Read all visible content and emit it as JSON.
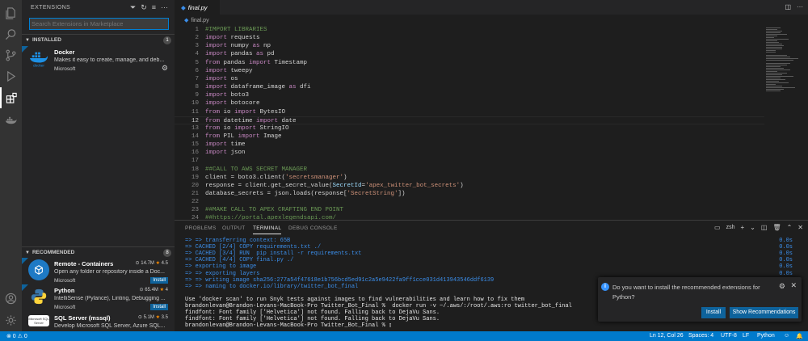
{
  "activity": {
    "icons": [
      "explorer-icon",
      "search-icon",
      "source-control-icon",
      "run-debug-icon",
      "extensions-icon",
      "docker-icon"
    ],
    "bottom": [
      "accounts-icon",
      "manage-icon"
    ]
  },
  "sidebar": {
    "title": "EXTENSIONS",
    "search_placeholder": "Search Extensions in Marketplace",
    "installed_label": "INSTALLED",
    "installed_count": "1",
    "installed": [
      {
        "name": "Docker",
        "desc": "Makes it easy to create, manage, and deb...",
        "publisher": "Microsoft",
        "logo_text": "docker",
        "color": "#1d91e6"
      }
    ],
    "recommended_label": "RECOMMENDED",
    "recommended_count": "8",
    "recommended": [
      {
        "name": "Remote - Containers",
        "downloads": "14.7M",
        "rating": "4.5",
        "desc": "Open any folder or repository inside a Doc...",
        "publisher": "Microsoft",
        "install": "Install",
        "color": "#1e7ac5"
      },
      {
        "name": "Python",
        "downloads": "65.4M",
        "rating": "4",
        "desc": "IntelliSense (Pylance), Linting, Debugging ...",
        "publisher": "Microsoft",
        "install": "Install",
        "color": "#3a6e9e"
      },
      {
        "name": "SQL Server (mssql)",
        "downloads": "5.1M",
        "rating": "3.5",
        "desc": "Develop Microsoft SQL Server, Azure SQL...",
        "publisher": "",
        "install": "",
        "color": "#ffffff",
        "logo_text": "Microsoft SQL Server"
      }
    ]
  },
  "editor": {
    "tab": "final.py",
    "breadcrumb": "final.py",
    "current_line": 12,
    "lines": [
      [
        [
          "c",
          "#IMPORT LIBRARIES"
        ]
      ],
      [
        [
          "k",
          "import"
        ],
        [
          "t",
          " requests"
        ]
      ],
      [
        [
          "k",
          "import"
        ],
        [
          "t",
          " numpy "
        ],
        [
          "k",
          "as"
        ],
        [
          "t",
          " np"
        ]
      ],
      [
        [
          "k",
          "import"
        ],
        [
          "t",
          " pandas "
        ],
        [
          "k",
          "as"
        ],
        [
          "t",
          " pd"
        ]
      ],
      [
        [
          "k",
          "from"
        ],
        [
          "t",
          " pandas "
        ],
        [
          "k",
          "import"
        ],
        [
          "t",
          " Timestamp"
        ]
      ],
      [
        [
          "k",
          "import"
        ],
        [
          "t",
          " tweepy"
        ]
      ],
      [
        [
          "k",
          "import"
        ],
        [
          "t",
          " os"
        ]
      ],
      [
        [
          "k",
          "import"
        ],
        [
          "t",
          " dataframe_image "
        ],
        [
          "k",
          "as"
        ],
        [
          "t",
          " dfi"
        ]
      ],
      [
        [
          "k",
          "import"
        ],
        [
          "t",
          " boto3"
        ]
      ],
      [
        [
          "k",
          "import"
        ],
        [
          "t",
          " botocore"
        ]
      ],
      [
        [
          "k",
          "from"
        ],
        [
          "t",
          " io "
        ],
        [
          "k",
          "import"
        ],
        [
          "t",
          " BytesIO"
        ]
      ],
      [
        [
          "k",
          "from"
        ],
        [
          "t",
          " datetime "
        ],
        [
          "k",
          "import"
        ],
        [
          "t",
          " date"
        ]
      ],
      [
        [
          "k",
          "from"
        ],
        [
          "t",
          " io "
        ],
        [
          "k",
          "import"
        ],
        [
          "t",
          " StringIO"
        ]
      ],
      [
        [
          "k",
          "from"
        ],
        [
          "t",
          " PIL "
        ],
        [
          "k",
          "import"
        ],
        [
          "t",
          " Image"
        ]
      ],
      [
        [
          "k",
          "import"
        ],
        [
          "t",
          " time"
        ]
      ],
      [
        [
          "k",
          "import"
        ],
        [
          "t",
          " json"
        ]
      ],
      [],
      [
        [
          "c",
          "##CALL TO AWS SECRET MANAGER"
        ]
      ],
      [
        [
          "t",
          "client = boto3.client("
        ],
        [
          "s",
          "'secretsmanager'"
        ],
        [
          "t",
          ")"
        ]
      ],
      [
        [
          "t",
          "response = client.get_secret_value("
        ],
        [
          "p",
          "SecretId"
        ],
        [
          "t",
          "="
        ],
        [
          "s",
          "'apex_twitter_bot_secrets'"
        ],
        [
          "t",
          ")"
        ]
      ],
      [
        [
          "t",
          "database_secrets = json.loads(response["
        ],
        [
          "s",
          "'SecretString'"
        ],
        [
          "t",
          "])"
        ]
      ],
      [],
      [
        [
          "c",
          "##MAKE CALL TO APEX CRAFTING END POINT"
        ]
      ],
      [
        [
          "c",
          "##https://portal.apexlegendsapi.com/"
        ]
      ]
    ]
  },
  "panel": {
    "tabs": [
      "PROBLEMS",
      "OUTPUT",
      "TERMINAL",
      "DEBUG CONSOLE"
    ],
    "active_tab": "TERMINAL",
    "shell": "zsh",
    "terminal": [
      {
        "text": "=> => transferring context: 65B",
        "right": "0.0s",
        "cls": "blue"
      },
      {
        "text": "=> CACHED [2/4] COPY requirements.txt ./",
        "right": "0.0s",
        "cls": "blue"
      },
      {
        "text": "=> CACHED [3/4] RUN  pip install -r requirements.txt",
        "right": "0.0s",
        "cls": "blue"
      },
      {
        "text": "=> CACHED [4/4] COPY final.py ./",
        "right": "0.0s",
        "cls": "blue"
      },
      {
        "text": "=> exporting to image",
        "right": "0.0s",
        "cls": "blue"
      },
      {
        "text": "=> => exporting layers",
        "right": "0.0s",
        "cls": "blue"
      },
      {
        "text": "=> => writing image sha256:277a54f47618e1b756bcd5ed91c2a5e9422fa9ff1cce031d413943546ddf6139",
        "right": "",
        "cls": "blue"
      },
      {
        "text": "=> => naming to docker.io/library/twitter_bot_final",
        "right": "",
        "cls": "blue"
      },
      {
        "text": "",
        "right": "",
        "cls": "w"
      },
      {
        "text": "Use 'docker scan' to run Snyk tests against images to find vulnerabilities and learn how to fix them",
        "right": "",
        "cls": "w"
      },
      {
        "text": "brandonlevan@Brandon-Levans-MacBook-Pro Twitter_Bot_Final %  docker run -v ~/.aws/:/root/.aws:ro twitter_bot_final",
        "right": "",
        "cls": "w"
      },
      {
        "text": "findfont: Font family ['Helvetica'] not found. Falling back to DejaVu Sans.",
        "right": "",
        "cls": "w"
      },
      {
        "text": "findfont: Font family ['Helvetica'] not found. Falling back to DejaVu Sans.",
        "right": "",
        "cls": "w"
      },
      {
        "text": "brandonlevan@Brandon-Levans-MacBook-Pro Twitter_Bot_Final % ▯",
        "right": "",
        "cls": "w"
      }
    ]
  },
  "notification": {
    "text": "Do you want to install the recommended extensions for Python?",
    "install": "Install",
    "show": "Show Recommendations"
  },
  "status": {
    "problems": "⊗ 0 ⚠ 0",
    "position": "Ln 12, Col 26",
    "spaces": "Spaces: 4",
    "encoding": "UTF-8",
    "eol": "LF",
    "language": "Python"
  }
}
